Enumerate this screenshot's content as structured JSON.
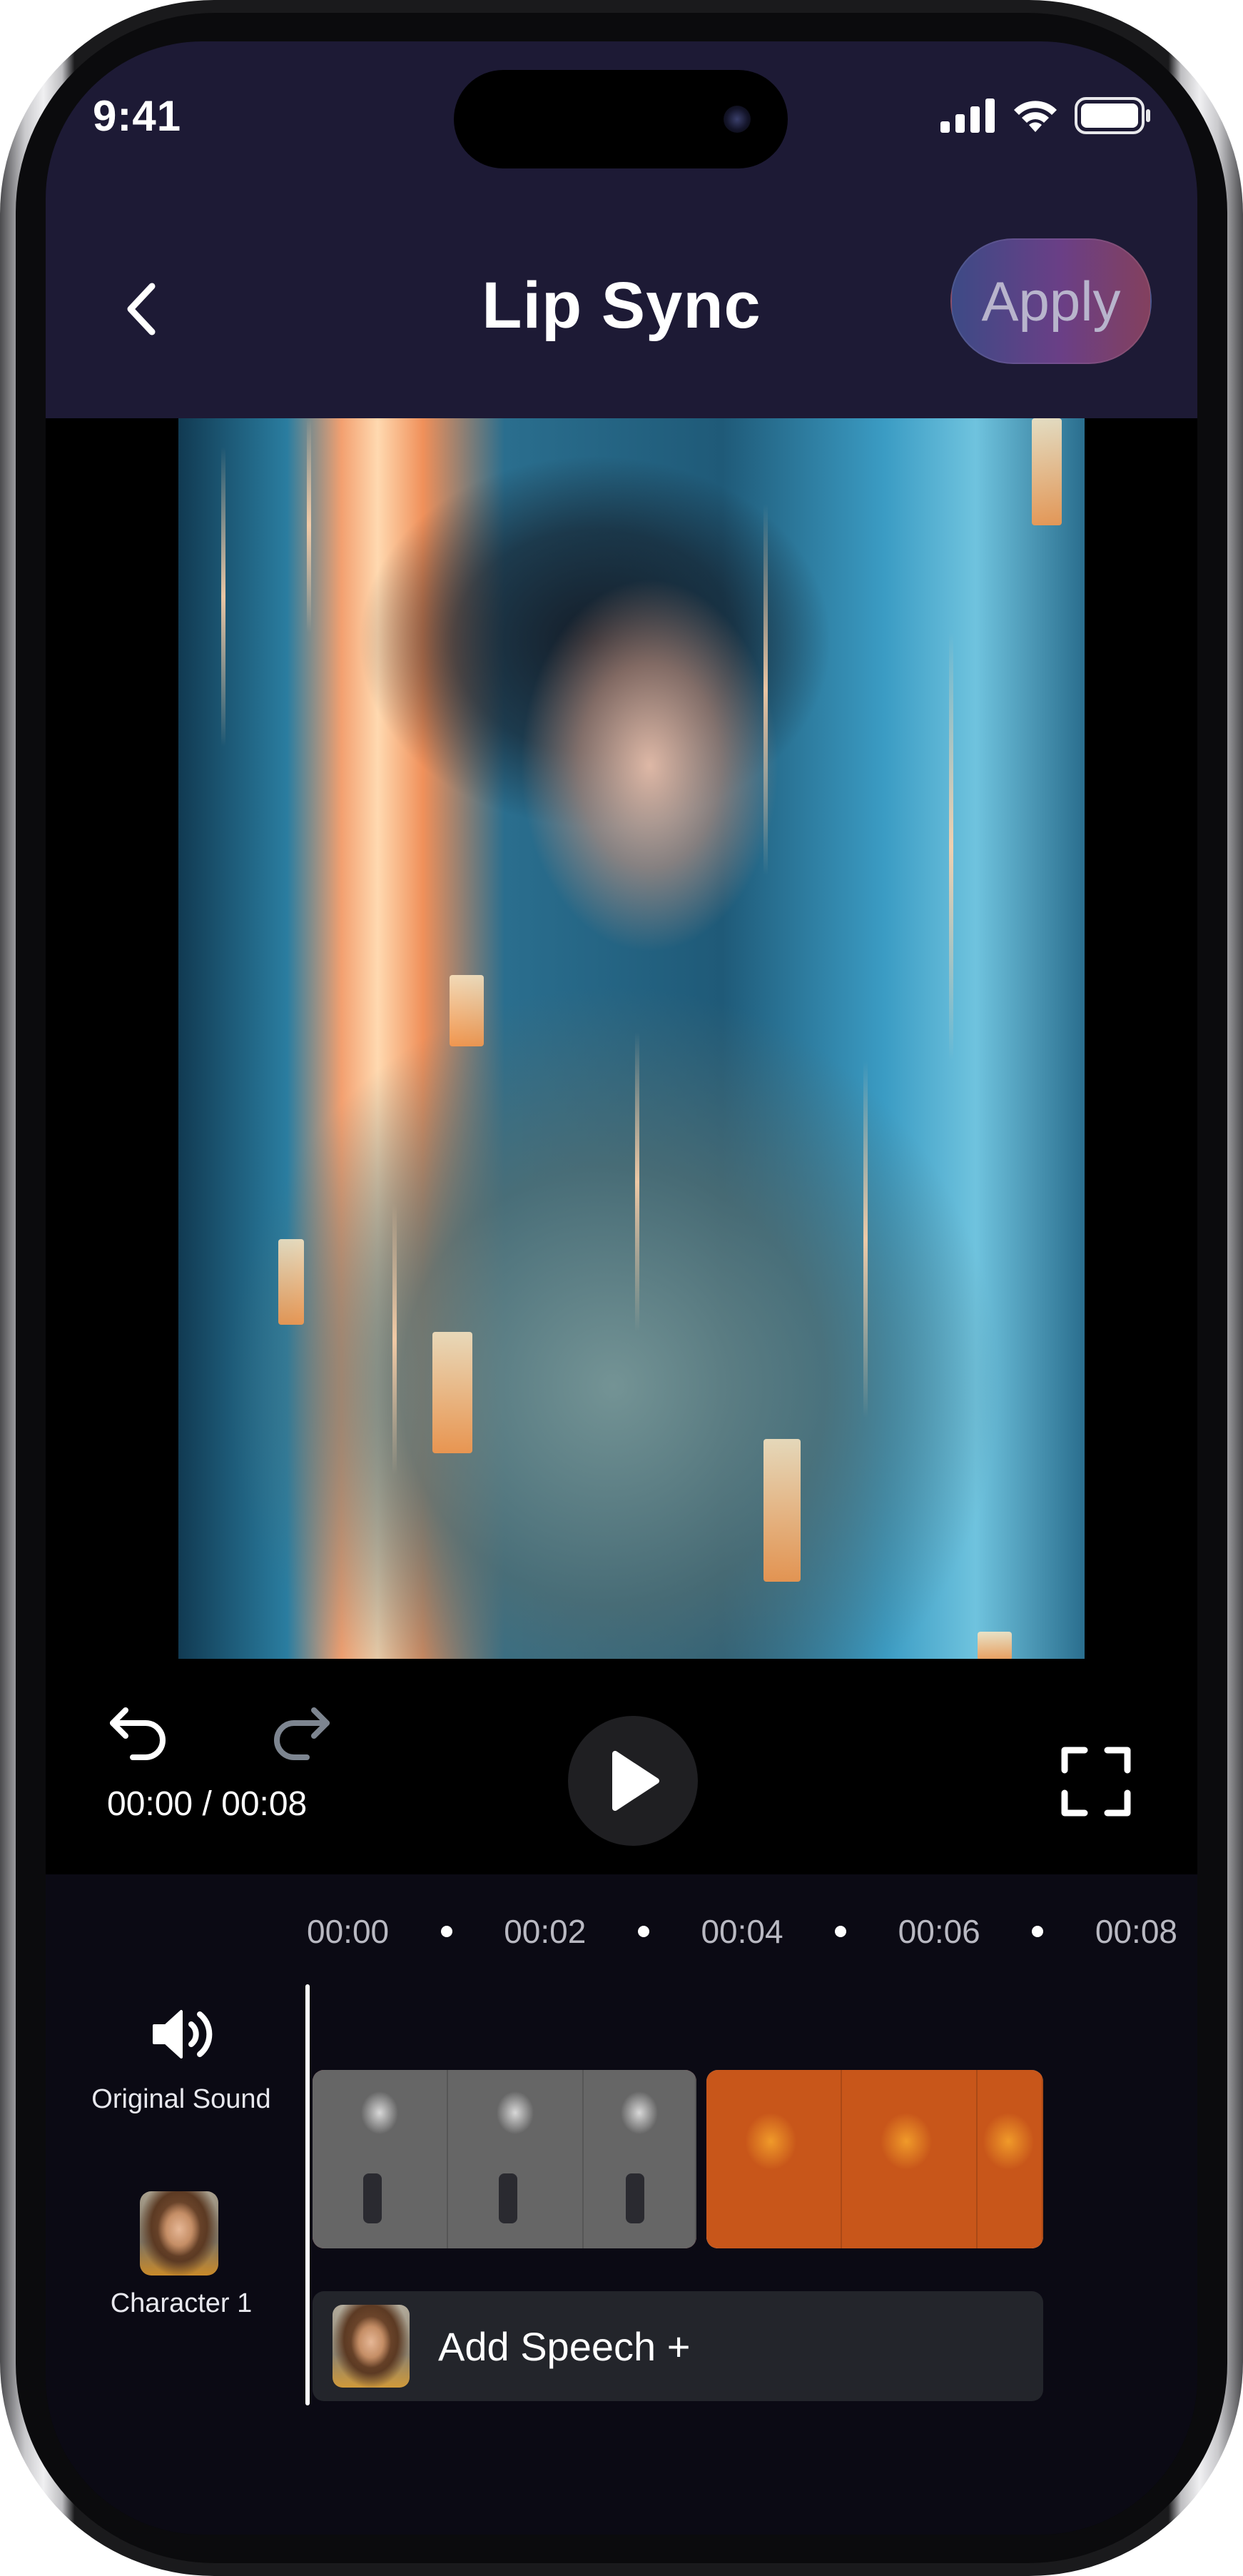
{
  "status_bar": {
    "time": "9:41",
    "icons": [
      "cellular-signal-icon",
      "wifi-icon",
      "battery-icon"
    ]
  },
  "header": {
    "back_icon": "chevron-left-icon",
    "title": "Lip Sync",
    "apply_label": "Apply"
  },
  "player": {
    "timecode": "00:00 / 00:08",
    "undo_icon": "undo-icon",
    "redo_icon": "redo-icon",
    "play_icon": "play-icon",
    "fullscreen_icon": "fullscreen-icon"
  },
  "timeline": {
    "ruler_labels": [
      "00:00",
      "00:02",
      "00:04",
      "00:06",
      "00:08"
    ],
    "tracks": [
      {
        "label": "Original Sound",
        "icon": "speaker-icon"
      },
      {
        "label": "Character 1",
        "icon": "character-avatar"
      }
    ],
    "add_speech_label": "Add Speech +"
  },
  "colors": {
    "header_bg": "#1d1a35",
    "apply_gradient_start": "#3d4a86",
    "apply_gradient_end": "#83405e",
    "timeline_bg": "#0b0a14",
    "speech_bar_bg": "#23252b"
  }
}
